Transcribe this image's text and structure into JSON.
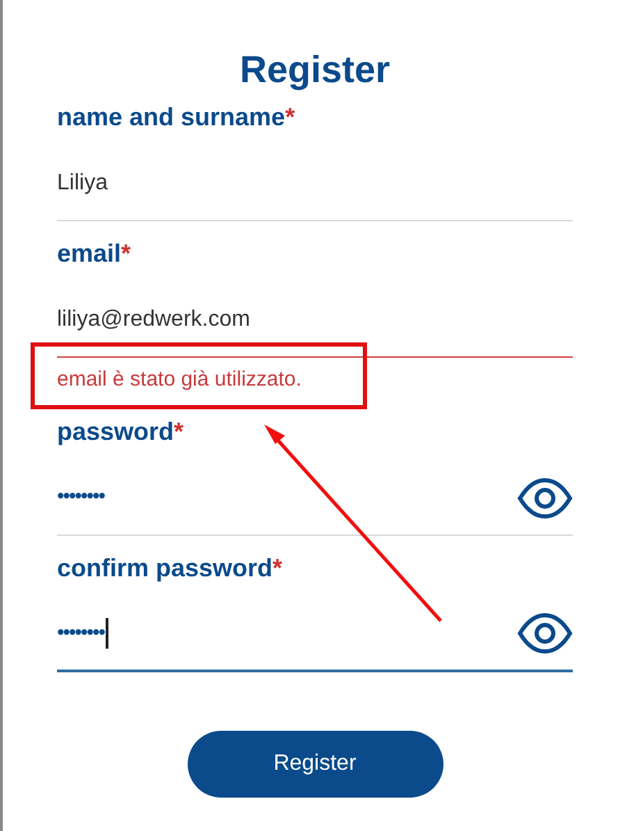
{
  "title": "Register",
  "fields": [
    {
      "label": "name and surname",
      "required_mark": "*",
      "value": "Liliya",
      "kind": "text",
      "error": false,
      "focused": false
    },
    {
      "label": "email",
      "required_mark": "*",
      "value": "liliya@redwerk.com",
      "kind": "text",
      "error": true,
      "focused": false,
      "error_message": "email è stato già utilizzato."
    },
    {
      "label": "password",
      "required_mark": "*",
      "value": "••••••••",
      "kind": "password",
      "error": false,
      "focused": false
    },
    {
      "label": "confirm password",
      "required_mark": "*",
      "value": "••••••••",
      "kind": "password",
      "error": false,
      "focused": true
    }
  ],
  "button": "Register"
}
